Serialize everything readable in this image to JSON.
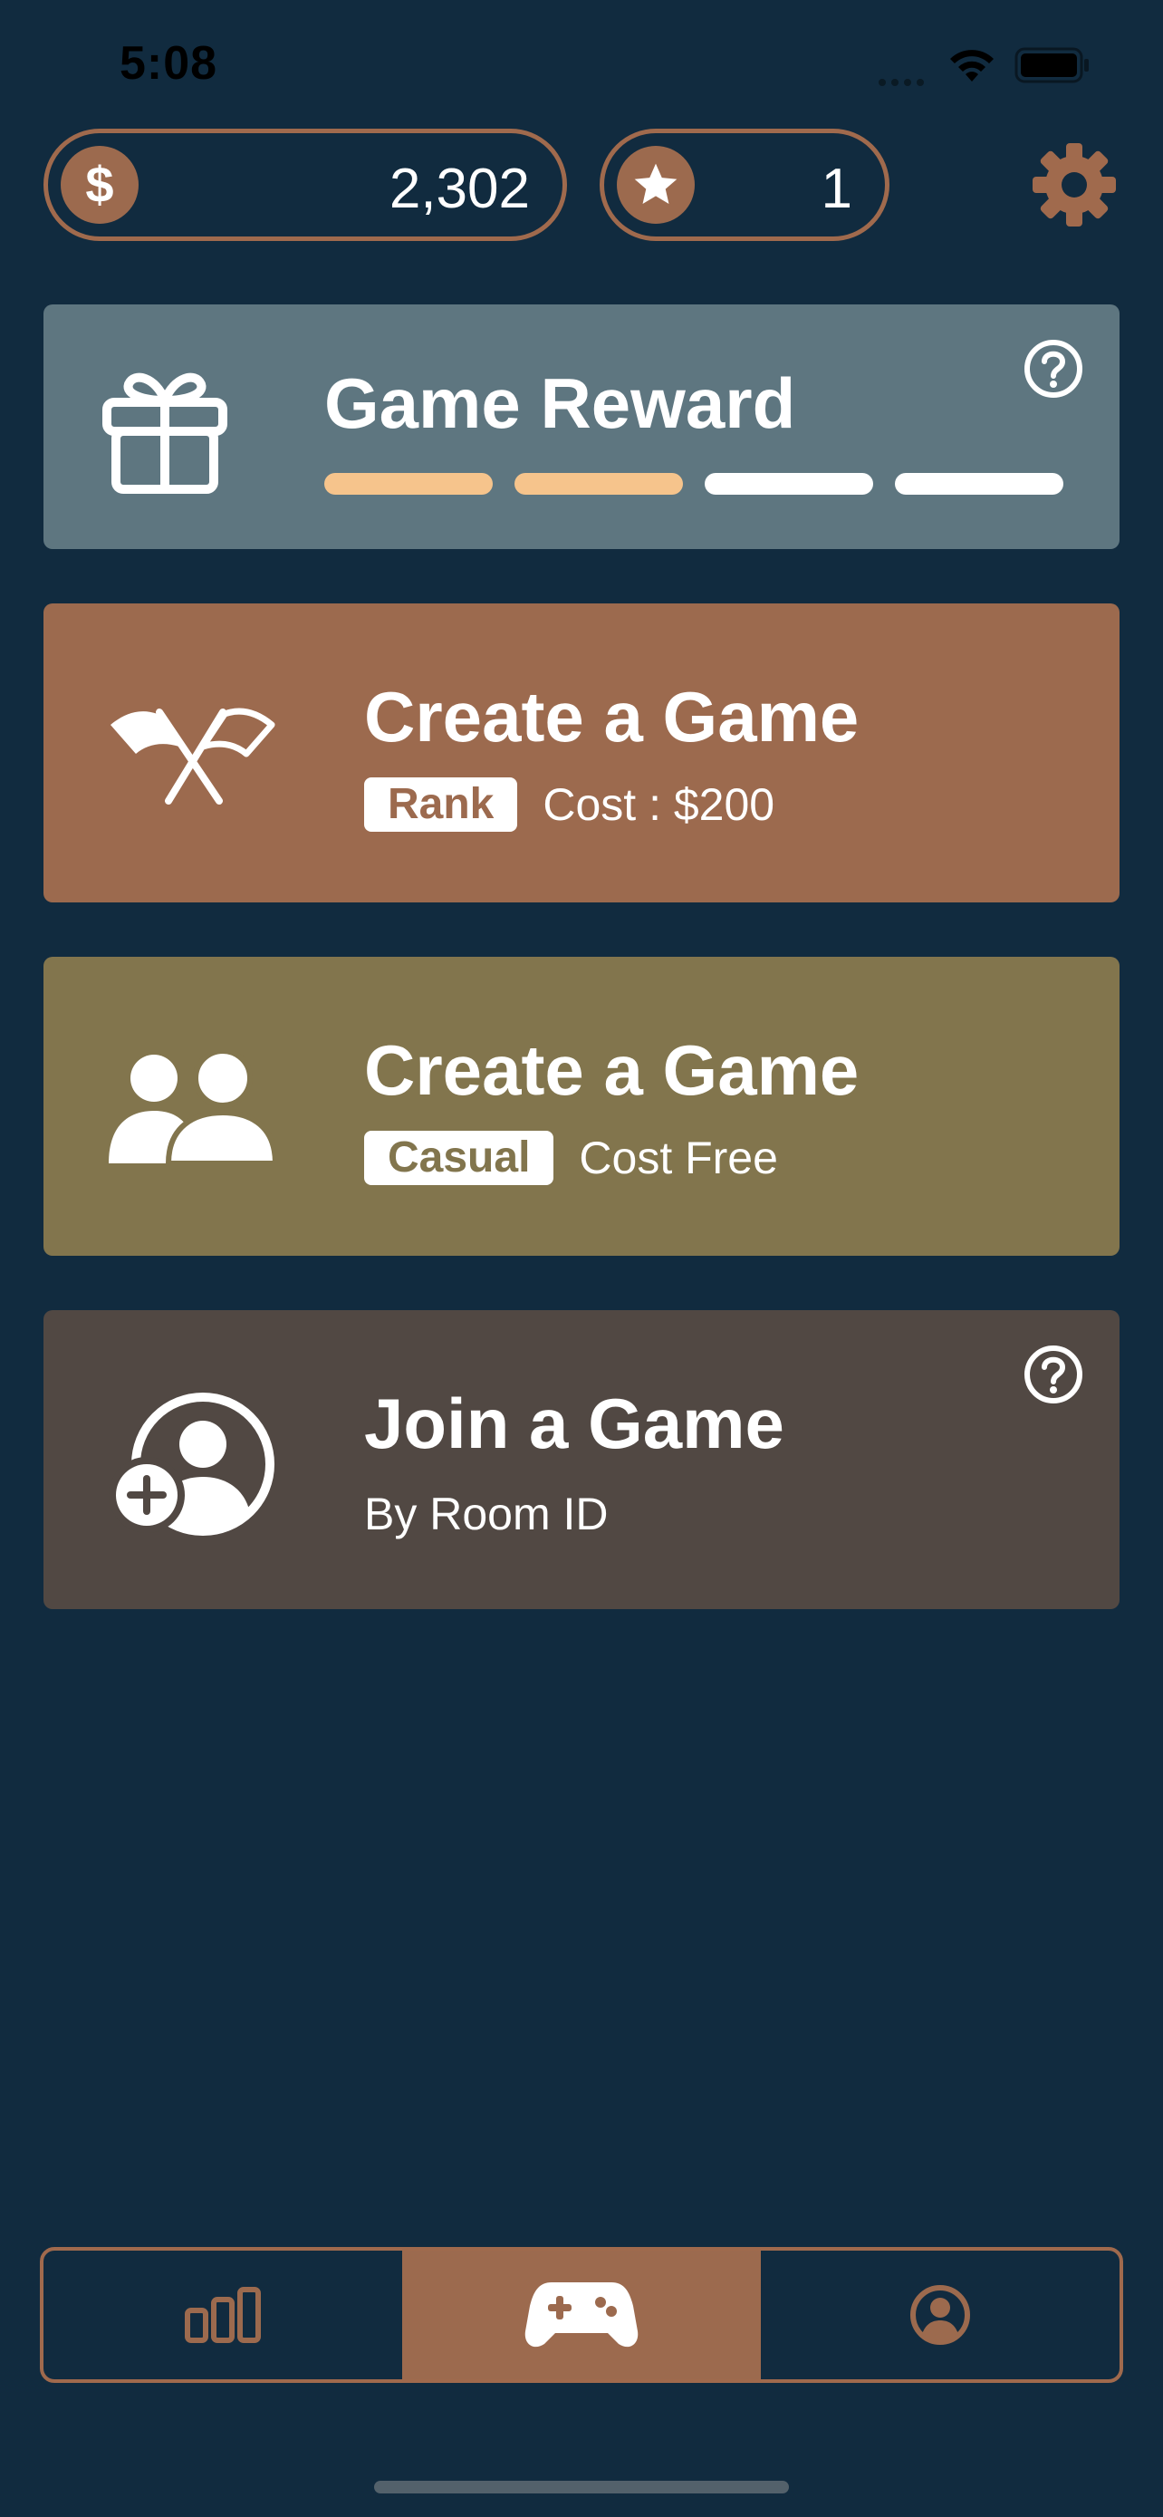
{
  "status_bar": {
    "time": "5:08"
  },
  "currency": {
    "money_icon": "dollar-icon",
    "money_symbol": "$",
    "money_value": "2,302",
    "stars_icon": "star-icon",
    "stars_value": "1"
  },
  "header": {
    "settings_icon": "gear-icon"
  },
  "reward_card": {
    "title": "Game Reward",
    "icon": "gift-icon",
    "progress_total_segments": 4,
    "progress_filled_segments": 2,
    "help_icon": "help-icon"
  },
  "rank_card": {
    "title": "Create a Game",
    "tag": "Rank",
    "cost": "Cost : $200",
    "icon": "flags-icon"
  },
  "casual_card": {
    "title": "Create a Game",
    "tag": "Casual",
    "cost": "Cost Free",
    "icon": "people-icon"
  },
  "join_card": {
    "title": "Join a Game",
    "subtitle": "By Room ID",
    "icon": "add-user-icon",
    "help_icon": "help-icon"
  },
  "tab_bar": {
    "tabs": [
      {
        "icon": "leaderboard-icon",
        "active": false
      },
      {
        "icon": "gamepad-icon",
        "active": true
      },
      {
        "icon": "profile-icon",
        "active": false
      }
    ]
  },
  "colors": {
    "background": "#112b3f",
    "accent": "#9c6a4e",
    "reward_card": "#5e7680",
    "rank_card": "#9c6a4e",
    "casual_card": "#82754d",
    "join_card": "#514843",
    "progress_filled": "#f6c48c",
    "progress_empty": "#ffffff"
  }
}
